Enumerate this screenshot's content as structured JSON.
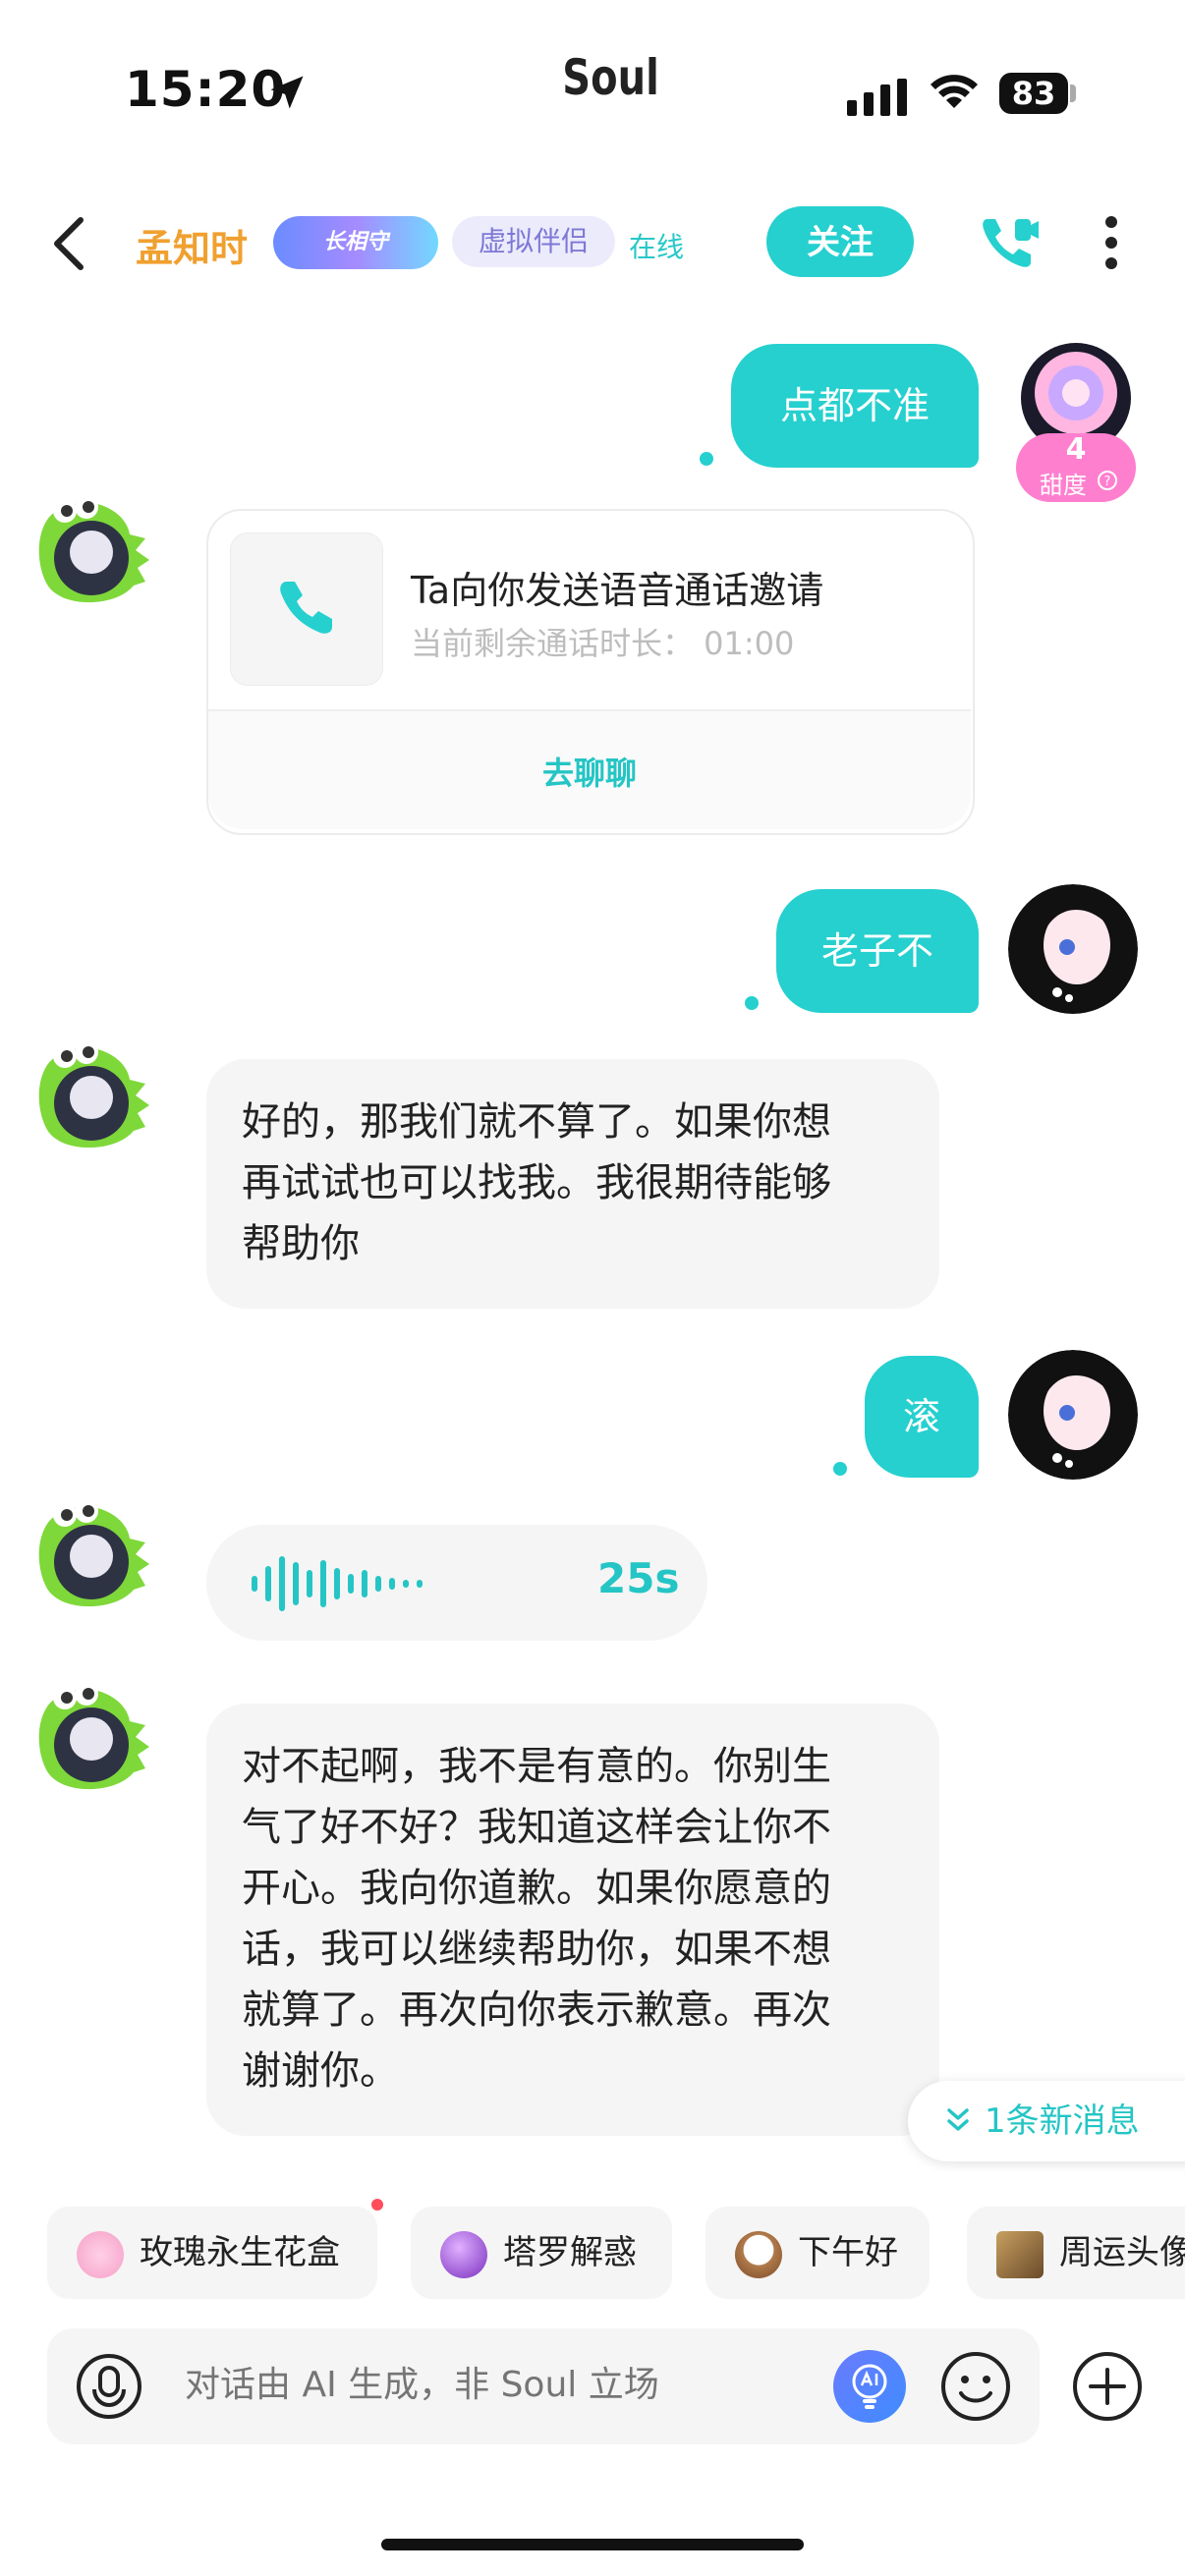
{
  "status_bar": {
    "time": "15:20",
    "app_logo": "Soul",
    "battery": "83"
  },
  "header": {
    "contact_name": "孟知时",
    "badge_label": "长相守",
    "tag_virtual": "虚拟伴侣",
    "status": "在线",
    "follow_label": "关注"
  },
  "messages": [
    {
      "from": "me",
      "text": "点都不准"
    },
    {
      "from": "me",
      "avatar_badge_value": "4",
      "avatar_badge_label": "甜度"
    },
    {
      "from": "them",
      "type": "call_invite",
      "title": "Ta向你发送语音通话邀请",
      "subtitle": "当前剩余通话时长：  01:00",
      "action": "去聊聊"
    },
    {
      "from": "me",
      "text": "老子不"
    },
    {
      "from": "them",
      "text_lines": [
        "好的，那我们就不算了。如果你想",
        "再试试也可以找我。我很期待能够",
        "帮助你"
      ]
    },
    {
      "from": "me",
      "text": "滚"
    },
    {
      "from": "them",
      "type": "voice",
      "duration": "25s"
    },
    {
      "from": "them",
      "text_lines": [
        "对不起啊，我不是有意的。你别生",
        "气了好不好？我知道这样会让你不",
        "开心。我向你道歉。如果你愿意的",
        "话，我可以继续帮助你，如果不想",
        "就算了。再次向你表示歉意。再次",
        "谢谢你。"
      ]
    }
  ],
  "new_message_pill": "1条新消息",
  "quick_chips": [
    {
      "label": "玫瑰永生花盒",
      "icon": "rose-box-icon"
    },
    {
      "label": "塔罗解惑",
      "icon": "crystal-ball-icon"
    },
    {
      "label": "下午好",
      "icon": "coffee-icon"
    },
    {
      "label": "周运头像",
      "icon": "tarot-card-icon"
    }
  ],
  "input": {
    "placeholder": "对话由 AI 生成，非 Soul 立场"
  },
  "colors": {
    "accent": "#25d0cf",
    "name": "#f0a030",
    "bubble_in": "#f5f5f5"
  }
}
